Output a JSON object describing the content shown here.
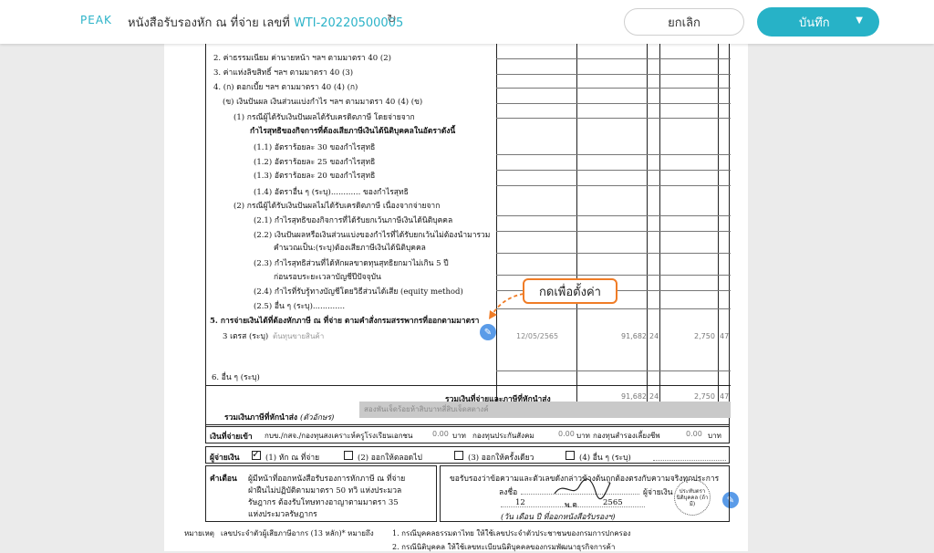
{
  "header": {
    "logo": "PEAK",
    "title": "หนังสือรับรองหัก ณ ที่จ่าย เลขที่",
    "doc_no": "WTI-20220500005",
    "cancel_label": "ยกเลิก",
    "save_label": "บันทึก"
  },
  "callout": "กดเพื่อตั้งค่า",
  "form": {
    "lines": [
      "2. ค่าธรรมเนียม ค่านายหน้า ฯลฯ ตามมาตรา 40 (2)",
      "3. ค่าแห่งลิขสิทธิ์ ฯลฯ ตามมาตรา 40 (3)",
      "4. (ก) ดอกเบี้ย ฯลฯ ตามมาตรา 40 (4) (ก)",
      "(ข) เงินปันผล เงินส่วนแบ่งกำไร ฯลฯ ตามมาตรา 40 (4) (ข)",
      "(1) กรณีผู้ได้รับเงินปันผลได้รับเครดิตภาษี โดยจ่ายจาก",
      "กำไรสุทธิของกิจการที่ต้องเสียภาษีเงินได้นิติบุคคลในอัตราดังนี้",
      "(1.1) อัตราร้อยละ 30 ของกำไรสุทธิ",
      "(1.2) อัตราร้อยละ 25 ของกำไรสุทธิ",
      "(1.3) อัตราร้อยละ 20 ของกำไรสุทธิ",
      "(1.4) อัตราอื่น ๆ (ระบุ)............ ของกำไรสุทธิ",
      "(2) กรณีผู้ได้รับเงินปันผลไม่ได้รับเครดิตภาษี เนื่องจากจ่ายจาก",
      "(2.1) กำไรสุทธิของกิจการที่ได้รับยกเว้นภาษีเงินได้นิติบุคคล",
      "(2.2) เงินปันผลหรือเงินส่วนแบ่งของกำไรที่ได้รับยกเว้นไม่ต้องนำมารวม",
      "คำนวณเป็น:(ระบุ)ต้องเสียภาษีเงินได้นิติบุคคล",
      "(2.3) กำไรสุทธิส่วนที่ได้หักผลขาดทุนสุทธิยกมาไม่เกิน 5 ปี",
      "ก่อนรอบระยะเวลาบัญชีปีปัจจุบัน",
      "(2.4) กำไรที่รับรู้ทางบัญชีโดยวิธีส่วนได้เสีย (equity method)",
      "(2.5) อื่น ๆ (ระบุ).............",
      "5. การจ่ายเงินได้ที่ต้องหักภาษี ณ ที่จ่าย ตามคำสั่งกรมสรรพากรที่ออกตามมาตรา",
      "3 เตรส (ระบุ)",
      "6. อื่น ๆ (ระบุ)"
    ],
    "row5": {
      "description": "ต้นทุนขายสินค้า",
      "date": "12/05/2565",
      "amount": "91,682",
      "amount_dec": "24",
      "tax": "2,750",
      "tax_dec": "47"
    },
    "total": {
      "label": "รวมเงินที่จ่ายและภาษีที่หักนำส่ง",
      "amount": "91,682",
      "amount_dec": "24",
      "tax": "2,750",
      "tax_dec": "47"
    },
    "total_text": {
      "label": "รวมเงินภาษีที่หักนำส่ง",
      "label_suffix": "(ตัวอักษร)",
      "value": "สองพันเจ็ดร้อยห้าสิบบาทสี่สิบเจ็ดสตางค์"
    },
    "fund": {
      "label": "เงินที่จ่ายเข้า",
      "text": "กบข./กสจ./กองทุนสงเคราะห์ครูโรงเรียนเอกชน",
      "v1": "0.00",
      "unit": "บาท",
      "text2": "กองทุนประกันสังคม",
      "v2": "0.00",
      "text3": "กองทุนสำรองเลี้ยงชีพ",
      "v3": "0.00"
    },
    "payer": {
      "label": "ผู้จ่ายเงิน",
      "options": [
        "(1) หัก ณ ที่จ่าย",
        "(2) ออกให้ตลอดไป",
        "(3) ออกให้ครั้งเดียว",
        "(4) อื่น ๆ (ระบุ)"
      ],
      "checked_mark": "✓"
    },
    "warning": {
      "label": "คำเตือน",
      "text1": "ผู้มีหน้าที่ออกหนังสือรับรองการหักภาษี ณ ที่จ่าย",
      "text2": "ฝ่าฝืนไม่ปฏิบัติตามมาตรา 50 ทวิ แห่งประมวล",
      "text3": "รัษฎากร ต้องรับโทษทางอาญาตามมาตรา 35",
      "text4": "แห่งประมวลรัษฎากร"
    },
    "certify": {
      "text1": "ขอรับรองว่าข้อความและตัวเลขดังกล่าวข้างต้นถูกต้องตรงกับความจริงทุกประการ",
      "sign_label": "ลงชื่อ",
      "payer_word": "ผู้จ่ายเงิน",
      "day": "12",
      "month": "พ.ค.",
      "year": "2565",
      "date_caption": "(วัน เดือน ปี ที่ออกหนังสือรับรองฯ)",
      "stamp": "ประทับตรา นิติบุคคล (ถ้ามี)"
    },
    "footnote": {
      "label": "หมายเหตุ",
      "text": "เลขประจำตัวผู้เสียภาษีอากร (13 หลัก)* หมายถึง",
      "n1": "1. กรณีบุคคลธรรมดาไทย ให้ใช้เลขประจำตัวประชาชนของกรมการปกครอง",
      "n2": "2. กรณีนิติบุคคล ให้ใช้เลขทะเบียนนิติบุคคลของกรมพัฒนาธุรกิจการค้า"
    }
  }
}
